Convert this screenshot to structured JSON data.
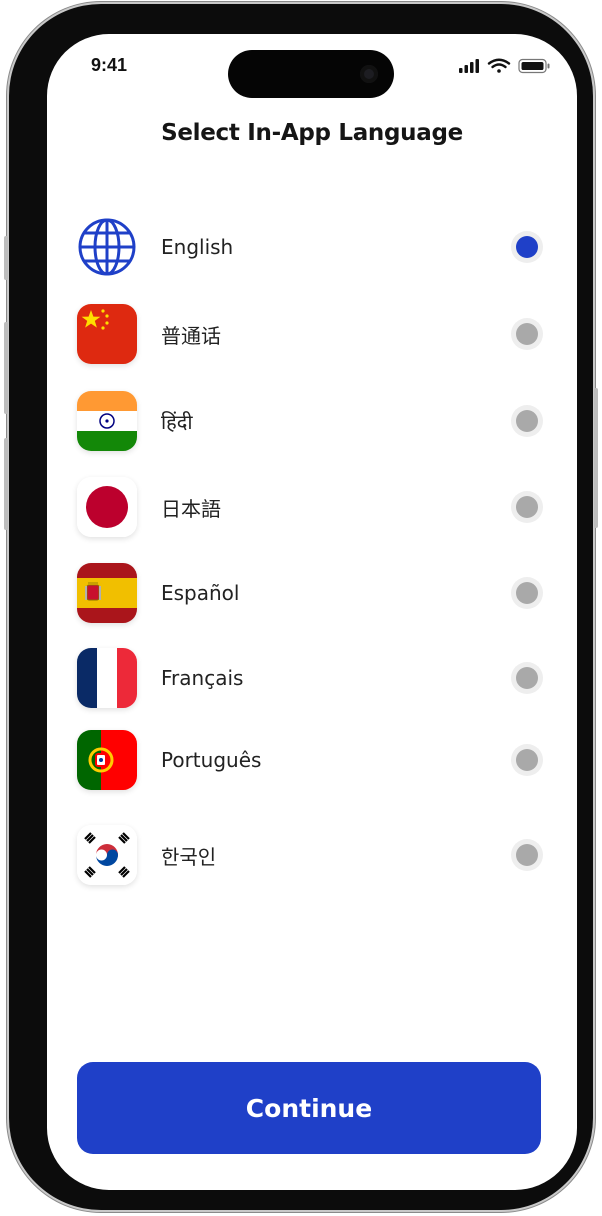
{
  "status_bar": {
    "time": "9:41",
    "icons": [
      "cellular-signal-icon",
      "wifi-icon",
      "battery-icon"
    ]
  },
  "header": {
    "title": "Select In-App Language"
  },
  "languages": [
    {
      "label": "English",
      "icon": "globe-icon",
      "selected": true
    },
    {
      "label": "普通话",
      "icon": "china-flag-icon",
      "selected": false
    },
    {
      "label": "हिंदी",
      "icon": "india-flag-icon",
      "selected": false
    },
    {
      "label": "日本語",
      "icon": "japan-flag-icon",
      "selected": false
    },
    {
      "label": "Español",
      "icon": "spain-flag-icon",
      "selected": false
    },
    {
      "label": "Français",
      "icon": "france-flag-icon",
      "selected": false
    },
    {
      "label": "Português",
      "icon": "portugal-flag-icon",
      "selected": false
    },
    {
      "label": "한국인",
      "icon": "south-korea-flag-icon",
      "selected": false
    }
  ],
  "footer": {
    "continue_label": "Continue"
  },
  "colors": {
    "accent": "#1f40c8",
    "radio_unselected": "#a9a9a9",
    "text": "#222222"
  }
}
